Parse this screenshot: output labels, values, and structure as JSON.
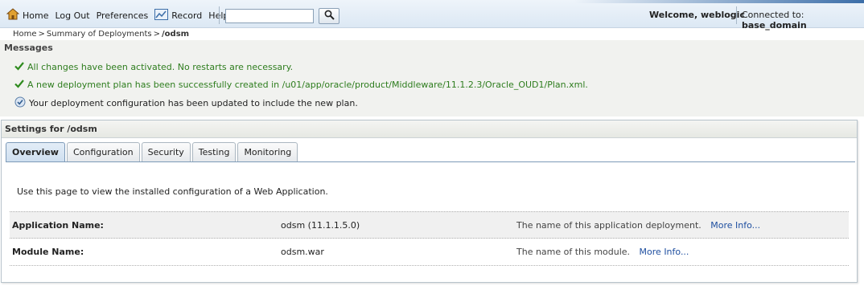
{
  "nav": {
    "home": "Home",
    "logout": "Log Out",
    "preferences": "Preferences",
    "record": "Record",
    "help": "Help"
  },
  "search": {
    "value": "",
    "placeholder": ""
  },
  "header": {
    "welcome": "Welcome, weblogic",
    "connected_label": "Connected to:",
    "domain": "base_domain"
  },
  "breadcrumb": {
    "home": "Home",
    "summary": "Summary of Deployments",
    "current": "/odsm"
  },
  "messages": {
    "title": "Messages",
    "items": [
      "All changes have been activated. No restarts are necessary.",
      "A new deployment plan has been successfully created in /u01/app/oracle/product/Middleware/11.1.2.3/Oracle_OUD1/Plan.xml.",
      "Your deployment configuration has been updated to include the new plan."
    ]
  },
  "settings": {
    "title": "Settings for /odsm",
    "tabs": [
      "Overview",
      "Configuration",
      "Security",
      "Testing",
      "Monitoring"
    ],
    "description": "Use this page to view the installed configuration of a Web Application.",
    "rows": [
      {
        "label": "Application Name:",
        "value": "odsm (11.1.1.5.0)",
        "note": "The name of this application deployment.",
        "more": "More Info..."
      },
      {
        "label": "Module Name:",
        "value": "odsm.war",
        "note": "The name of this module.",
        "more": "More Info..."
      }
    ]
  },
  "colors": {
    "accent": "#1f4fa0",
    "success": "#2e7d1e",
    "tab_active": "#cfdff0"
  },
  "icons": {
    "home": "home-icon",
    "record": "record-icon",
    "search": "search-icon",
    "success": "checkmark-icon",
    "info": "info-icon"
  }
}
